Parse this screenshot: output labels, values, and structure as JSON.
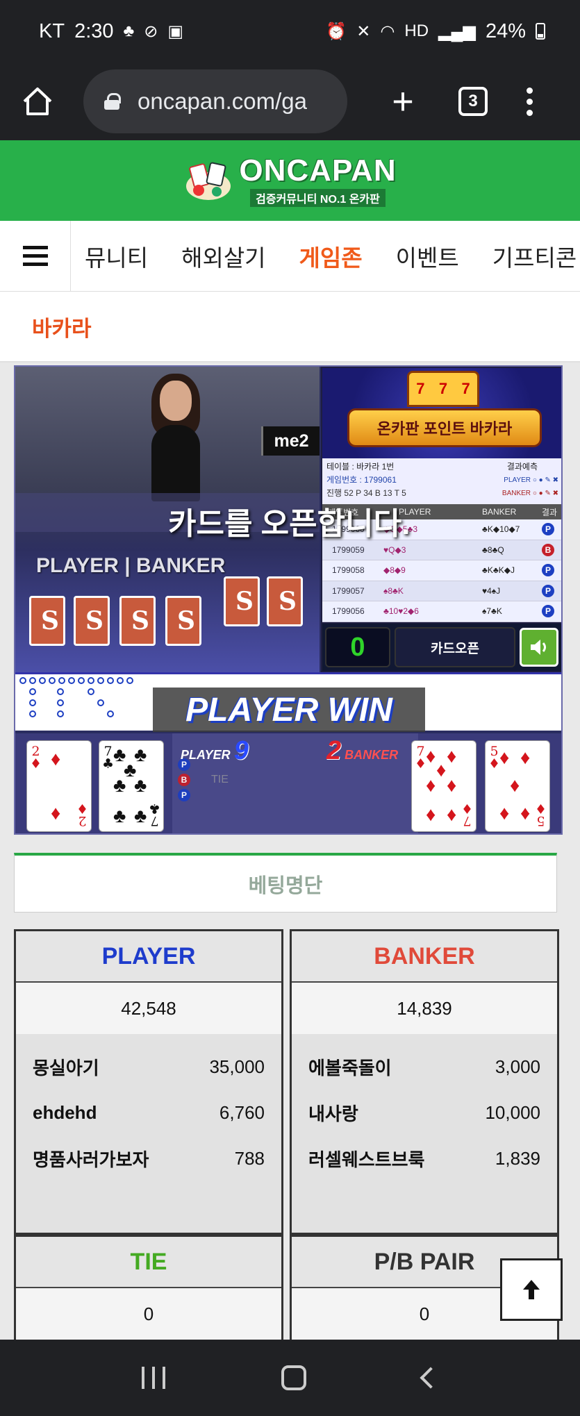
{
  "status_bar": {
    "carrier": "KT",
    "time": "2:30",
    "battery": "24%"
  },
  "browser": {
    "url": "oncapan.com/ga",
    "tab_count": "3"
  },
  "site": {
    "logo_main": "ONCAPAN",
    "logo_sub": "검증커뮤니티 NO.1 온카판"
  },
  "nav": {
    "items": [
      "뮤니티",
      "해외살기",
      "게임존",
      "이벤트",
      "기프티콘"
    ],
    "active_index": 2
  },
  "page_title": "바카라",
  "game": {
    "dealer_tag": "me2",
    "overlay_message": "카드를 오픈합니다.",
    "promo_title": "온카판 포인트 바카라",
    "table_name": "테이블 : 바카라 1번",
    "result_forecast": "결과예측",
    "game_number": "게임번호 : 1799061",
    "progress": "진행 52  P 34  B 13  T 5",
    "forecast_player": "PLAYER",
    "forecast_banker": "BANKER",
    "history_headers": [
      "게임번호",
      "PLAYER",
      "BANKER",
      "결과"
    ],
    "history": [
      {
        "id": "1799060",
        "player": "◆Q◆5♣3",
        "banker": "♣K◆10◆7",
        "result": "P"
      },
      {
        "id": "1799059",
        "player": "♥Q◆3",
        "banker": "♣8♣Q",
        "result": "B"
      },
      {
        "id": "1799058",
        "player": "◆8◆9",
        "banker": "♣K♣K◆J",
        "result": "P"
      },
      {
        "id": "1799057",
        "player": "♠8♣K",
        "banker": "♥4♠J",
        "result": "P"
      },
      {
        "id": "1799056",
        "player": "♣10♥2◆6",
        "banker": "♠7♣K",
        "result": "P"
      }
    ],
    "score": "0",
    "open_button": "카드오픈",
    "win_banner": "PLAYER WIN",
    "player_label": "PLAYER",
    "player_score": "9",
    "banker_label": "BANKER",
    "banker_score": "2",
    "board_letters": [
      "P",
      "B",
      "TIE"
    ],
    "pb_text": "PLAYER | BANKER",
    "cards": [
      {
        "rank": "2",
        "suit": "♦",
        "color": "red"
      },
      {
        "rank": "7",
        "suit": "♣",
        "color": "black"
      },
      {
        "rank": "7",
        "suit": "♦",
        "color": "red"
      },
      {
        "rank": "5",
        "suit": "♦",
        "color": "red"
      }
    ]
  },
  "betting": {
    "title": "베팅명단",
    "player": {
      "label": "PLAYER",
      "total": "42,548",
      "color": "#1e3ccc",
      "entries": [
        {
          "name": "몽실아기",
          "amount": "35,000"
        },
        {
          "name": "ehdehd",
          "amount": "6,760"
        },
        {
          "name": "명품사러가보자",
          "amount": "788"
        }
      ]
    },
    "banker": {
      "label": "BANKER",
      "total": "14,839",
      "color": "#e04a3a",
      "entries": [
        {
          "name": "에볼죽돌이",
          "amount": "3,000"
        },
        {
          "name": "내사랑",
          "amount": "10,000"
        },
        {
          "name": "러셀웨스트브룩",
          "amount": "1,839"
        }
      ]
    },
    "tie": {
      "label": "TIE",
      "total": "0",
      "color": "#44aa22"
    },
    "pair": {
      "label": "P/B PAIR",
      "total": "0",
      "color": "#333333"
    }
  }
}
